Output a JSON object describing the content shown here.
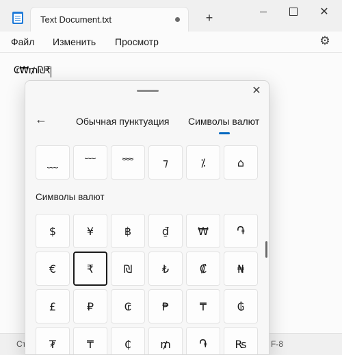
{
  "window": {
    "tab_title": "Text Document.txt",
    "new_tab_label": "+",
    "close_glyph": "✕"
  },
  "menu": {
    "items": [
      "Файл",
      "Изменить",
      "Просмотр"
    ],
    "settings_icon": "gear-icon"
  },
  "editor": {
    "text": "₢₩₥₪₹"
  },
  "status": {
    "left": "Ст",
    "right": "F-8"
  },
  "panel": {
    "close_glyph": "✕",
    "back_glyph": "←",
    "tabs": [
      "Обычная пунктуация",
      "Символы валют"
    ],
    "active_tab": "Символы валют",
    "prev_row": [
      "﹏",
      "﹋",
      "﹌",
      "⁊",
      "⁒",
      "⌂"
    ],
    "section_title": "Символы валют",
    "currency_rows": [
      [
        "$",
        "¥",
        "฿",
        "₫",
        "₩",
        "֏"
      ],
      [
        "€",
        "₹",
        "₪",
        "₺",
        "₡",
        "₦"
      ],
      [
        "£",
        "₽",
        "₢",
        "₱",
        "₸",
        "₲"
      ],
      [
        "₮",
        "₸",
        "₵",
        "₥",
        "֏",
        "₨"
      ]
    ],
    "selected_symbol": "₹"
  },
  "colors": {
    "accent": "#0067c0",
    "selected_border": "#1b1b1b"
  }
}
